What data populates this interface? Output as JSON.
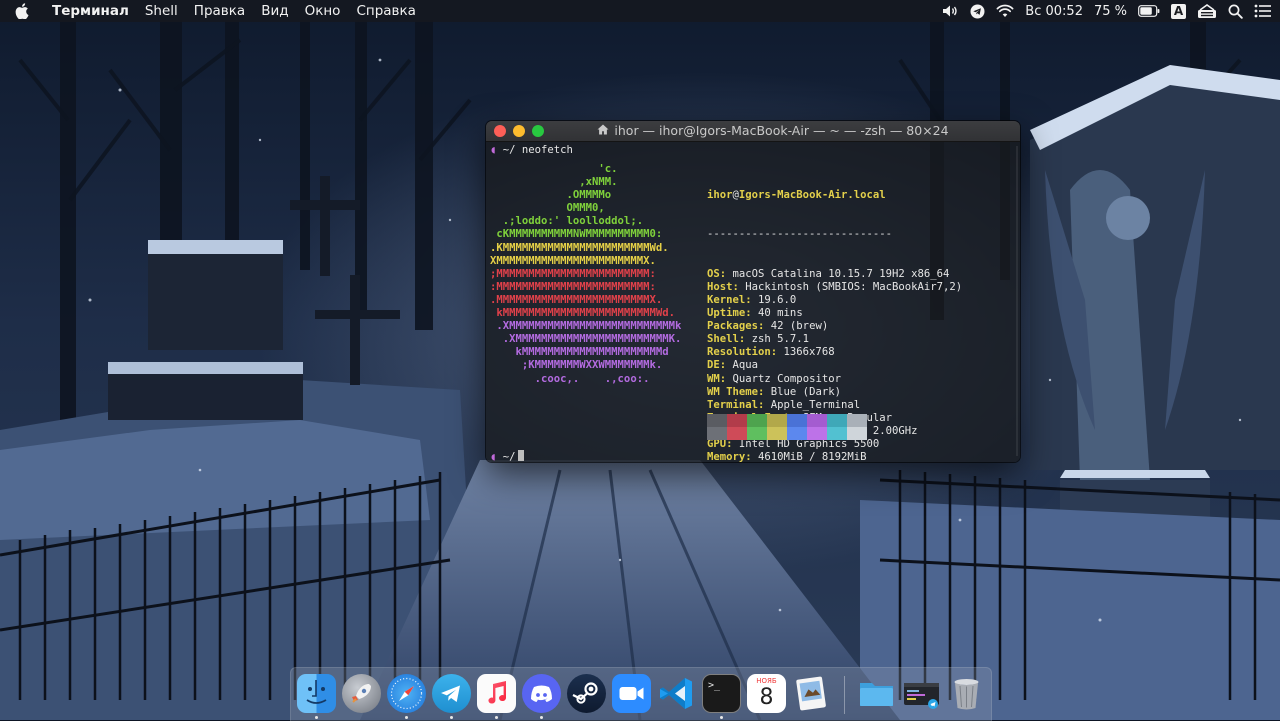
{
  "menubar": {
    "app_name": "Терминал",
    "menus": [
      "Shell",
      "Правка",
      "Вид",
      "Окно",
      "Справка"
    ],
    "clock": "Вс 00:52",
    "battery": "75 %",
    "input_source": "A"
  },
  "terminal": {
    "title": "ihor — ihor@Igors-MacBook-Air — ~ — -zsh — 80×24",
    "prompt1": "~/ neofetch",
    "prompt2": "~/",
    "logo": [
      {
        "text": "                 'c.",
        "color": "#7fd13b"
      },
      {
        "text": "              ,xNMM.",
        "color": "#7fd13b"
      },
      {
        "text": "            .OMMMMo",
        "color": "#7fd13b"
      },
      {
        "text": "            OMMM0,",
        "color": "#7fd13b"
      },
      {
        "text": "  .;loddo:' loolloddol;.",
        "color": "#7fd13b"
      },
      {
        "text": " cKMMMMMMMMMMNWMMMMMMMMMM0:",
        "color": "#7fd13b"
      },
      {
        "text": ".KMMMMMMMMMMMMMMMMMMMMMMMWd.",
        "color": "#e5d047"
      },
      {
        "text": "XMMMMMMMMMMMMMMMMMMMMMMMX.",
        "color": "#e5d047"
      },
      {
        "text": ";MMMMMMMMMMMMMMMMMMMMMMMM:",
        "color": "#e0414a"
      },
      {
        "text": ":MMMMMMMMMMMMMMMMMMMMMMMM:",
        "color": "#e0414a"
      },
      {
        "text": ".MMMMMMMMMMMMMMMMMMMMMMMMX.",
        "color": "#e0414a"
      },
      {
        "text": " kMMMMMMMMMMMMMMMMMMMMMMMMWd.",
        "color": "#e0414a"
      },
      {
        "text": " .XMMMMMMMMMMMMMMMMMMMMMMMMMMk",
        "color": "#b36be0"
      },
      {
        "text": "  .XMMMMMMMMMMMMMMMMMMMMMMMMK.",
        "color": "#b36be0"
      },
      {
        "text": "    kMMMMMMMMMMMMMMMMMMMMMMd",
        "color": "#b36be0"
      },
      {
        "text": "     ;KMMMMMMMWXXWMMMMMMMk.",
        "color": "#b36be0"
      },
      {
        "text": "       .cooc,.    .,coo:.",
        "color": "#b36be0"
      }
    ],
    "info": {
      "user": "ihor",
      "at": "@",
      "host": "Igors-MacBook-Air.local",
      "separator": "-----------------------------",
      "rows": [
        {
          "key": "OS",
          "value": "macOS Catalina 10.15.7 19H2 x86_64"
        },
        {
          "key": "Host",
          "value": "Hackintosh (SMBIOS: MacBookAir7,2)"
        },
        {
          "key": "Kernel",
          "value": "19.6.0"
        },
        {
          "key": "Uptime",
          "value": "40 mins"
        },
        {
          "key": "Packages",
          "value": "42 (brew)"
        },
        {
          "key": "Shell",
          "value": "zsh 5.7.1"
        },
        {
          "key": "Resolution",
          "value": "1366x768"
        },
        {
          "key": "DE",
          "value": "Aqua"
        },
        {
          "key": "WM",
          "value": "Quartz Compositor"
        },
        {
          "key": "WM Theme",
          "value": "Blue (Dark)"
        },
        {
          "key": "Terminal",
          "value": "Apple_Terminal"
        },
        {
          "key": "Terminal Font",
          "value": "SFMono-Regular"
        },
        {
          "key": "CPU",
          "value": "Intel i3-5005U (4) @ 2.00GHz"
        },
        {
          "key": "GPU",
          "value": "Intel HD Graphics 5500"
        },
        {
          "key": "Memory",
          "value": "4610MiB / 8192MiB"
        }
      ]
    },
    "palette_top": [
      "#5a5c62",
      "#b23c4a",
      "#4ea34e",
      "#b2a84a",
      "#4a72d6",
      "#a45cd0",
      "#3fa8b8",
      "#a9b0b8"
    ],
    "palette_bottom": [
      "#6d7077",
      "#cf4b58",
      "#5fbf5f",
      "#ccc25a",
      "#5c88ee",
      "#bd72e8",
      "#52c1d1",
      "#cfd5da"
    ]
  },
  "calendar": {
    "month": "НОЯБ",
    "day": "8"
  },
  "dock": {
    "items": [
      {
        "name": "finder",
        "running": true
      },
      {
        "name": "launchpad",
        "running": false
      },
      {
        "name": "safari",
        "running": true
      },
      {
        "name": "telegram",
        "running": true
      },
      {
        "name": "music",
        "running": true
      },
      {
        "name": "discord",
        "running": true
      },
      {
        "name": "steam",
        "running": false
      },
      {
        "name": "zoom",
        "running": false
      },
      {
        "name": "vscode",
        "running": false
      },
      {
        "name": "terminal",
        "running": true
      },
      {
        "name": "calendar",
        "running": false
      },
      {
        "name": "preview",
        "running": false
      }
    ],
    "terminal_icon_text": ">_"
  }
}
